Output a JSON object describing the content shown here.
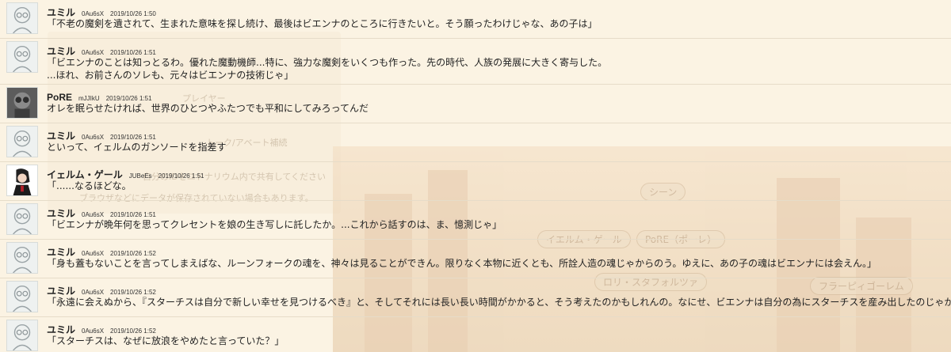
{
  "background": {
    "ghost_texts": [
      "プレイヤー",
      "トーク/アベート補続",
      "自分のIDをユドナリウム内で共有してください",
      "ブラウザなどにデータが保存されていない場合もあります。"
    ],
    "pills": [
      "シーン",
      "イエルム・ゲール",
      "PoRE（ポーレ）",
      "ロリ・スタフォルツァ",
      "フラーピィゴーレム"
    ]
  },
  "messages": [
    {
      "name": "ユミル",
      "uid": "0Au6sX",
      "time": "2019/10/26 1:50",
      "avatar": "yumil-avatar-icon",
      "lines": [
        "「不老の魔剣を遺されて、生まれた意味を探し続け、最後はビエンナのところに行きたいと。そう願ったわけじゃな、あの子は」"
      ]
    },
    {
      "name": "ユミル",
      "uid": "0Au6sX",
      "time": "2019/10/26 1:51",
      "avatar": "yumil-avatar-icon",
      "lines": [
        "「ビエンナのことは知っとるわ。優れた魔動機師...特に、強力な魔剣をいくつも作った。先の時代、人族の発展に大きく寄与した。",
        "...ほれ、お前さんのソレも、元々はビエンナの技術じゃ」"
      ]
    },
    {
      "name": "PoRE",
      "uid": "mJJIkU",
      "time": "2019/10/26 1:51",
      "avatar": "pore-avatar-icon",
      "lines": [
        "オレを眠らせたければ、世界のひとつやふたつでも平和にしてみろってんだ"
      ]
    },
    {
      "name": "ユミル",
      "uid": "0Au6sX",
      "time": "2019/10/26 1:51",
      "avatar": "yumil-avatar-icon",
      "lines": [
        "といって、イェルムのガンソードを指差す"
      ]
    },
    {
      "name": "イェルム・ゲール",
      "uid": "JUBeEs",
      "time": "2019/10/26 1:51",
      "avatar": "yelm-avatar-icon",
      "lines": [
        "「......なるほどな。"
      ]
    },
    {
      "name": "ユミル",
      "uid": "0Au6sX",
      "time": "2019/10/26 1:51",
      "avatar": "yumil-avatar-icon",
      "lines": [
        "「ビエンナが晩年何を思ってクレセントを娘の生き写しに託したか。...これから話すのは、ま、憶測じゃ」"
      ]
    },
    {
      "name": "ユミル",
      "uid": "0Au6sX",
      "time": "2019/10/26 1:52",
      "avatar": "yumil-avatar-icon",
      "lines": [
        "「身も蓋もないことを言ってしまえばな、ルーンフォークの魂を、神々は見ることができん。限りなく本物に近くとも、所詮人造の魂じゃからのう。ゆえに、あの子の魂はビエンナには会えん。」"
      ]
    },
    {
      "name": "ユミル",
      "uid": "0Au6sX",
      "time": "2019/10/26 1:52",
      "avatar": "yumil-avatar-icon",
      "lines": [
        "「永遠に会えぬから、『スターチスは自分で新しい幸せを見つけるべき』と、そしてそれには長い長い時間がかかると、そう考えたのかもしれんの。なにせ、ビエンナは自分の為にスターチスを産み出したのじゃから」"
      ]
    },
    {
      "name": "ユミル",
      "uid": "0Au6sX",
      "time": "2019/10/26 1:52",
      "avatar": "yumil-avatar-icon",
      "lines": [
        "「スターチスは、なぜに放浪をやめたと言っていた？」"
      ]
    }
  ]
}
